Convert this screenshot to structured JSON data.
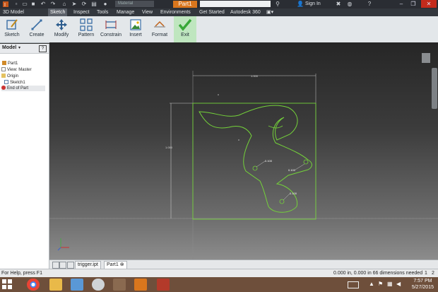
{
  "titlebar": {
    "material": "Material",
    "document_title": "Part1",
    "sign_in": "Sign In"
  },
  "menu_tabs": [
    "3D Model",
    "Sketch",
    "Inspect",
    "Tools",
    "Manage",
    "View",
    "Environments",
    "Get Started",
    "Autodesk 360"
  ],
  "active_tab": "Sketch",
  "ribbon": {
    "buttons": [
      "Sketch",
      "Create",
      "Modify",
      "Pattern",
      "Constrain",
      "Insert",
      "Format",
      "Exit"
    ],
    "icons": [
      "sketch-icon",
      "line-icon",
      "move-icon",
      "pattern-icon",
      "constrain-icon",
      "image-icon",
      "format-icon",
      "check-icon"
    ]
  },
  "browser": {
    "title": "Model",
    "items": [
      "Part1",
      "View: Master",
      "Origin",
      "Sketch1",
      "End of Part"
    ]
  },
  "drawing": {
    "dimension_top": "1.000",
    "dimension_left": "1.000",
    "label_1": "0.100",
    "label_2": "0.100",
    "label_3": "0.100"
  },
  "doc_tabs": [
    "trigger.ipt",
    "Part1"
  ],
  "status": {
    "help_text": "For Help, press F1",
    "coordinates": "0.000 in, 0.000 in 66 dimensions needed",
    "page_1": "1",
    "page_2": "2"
  },
  "clock": {
    "time": "7:57 PM",
    "date": "5/27/2015"
  },
  "colors": {
    "sketch_line": "#74d23a",
    "title_accent": "#d9761d",
    "exit_green": "#38a838"
  }
}
